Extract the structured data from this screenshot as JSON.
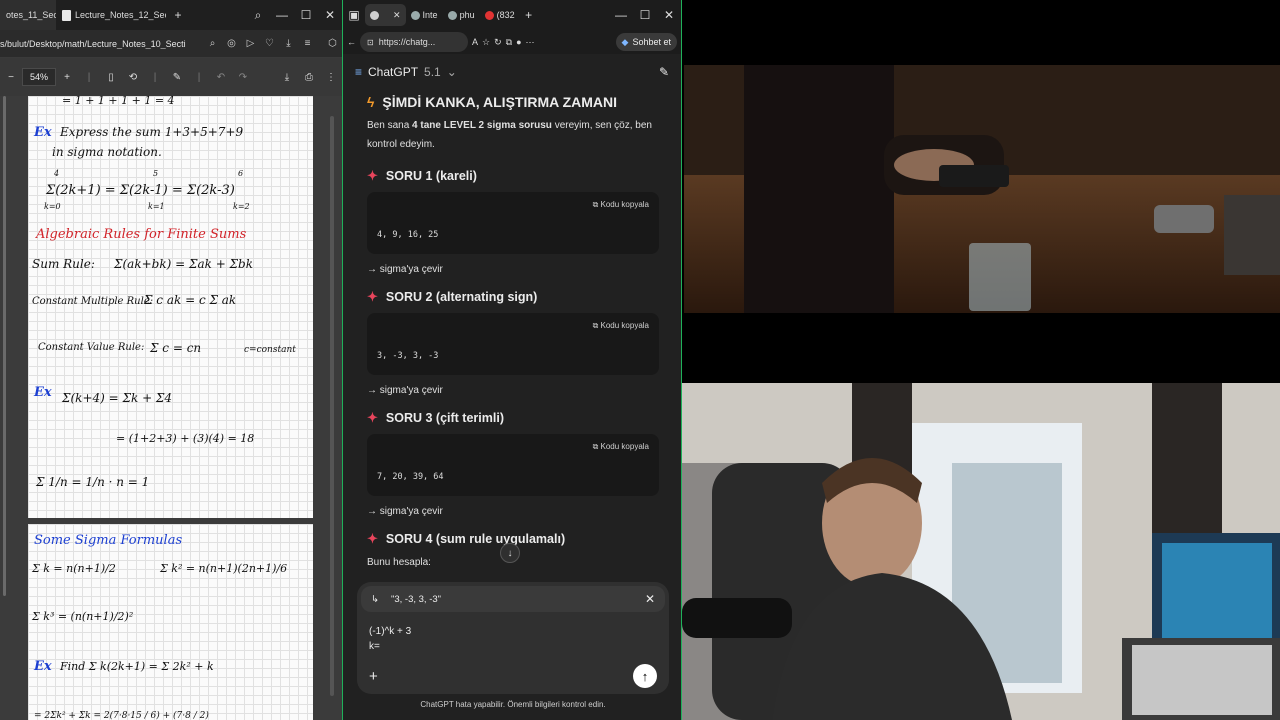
{
  "pdf": {
    "tabs": [
      {
        "label": "otes_11_Section"
      },
      {
        "label": "Lecture_Notes_12_Section"
      }
    ],
    "new_tab": "+",
    "address": "s/bulut/Desktop/math/Lecture_Notes_10_Secti",
    "zoom": "54%",
    "notes_page1": {
      "line_top": "= 1 + 1 + 1 + 1 = 4",
      "ex1_label": "Ex",
      "ex1_text": "Express the sum 1+3+5+7+9",
      "ex1_text2": "in sigma notation.",
      "ex1_sums": "Σ(2k+1) = Σ(2k-1) = Σ(2k-3)",
      "ex1_lims": [
        "k=0",
        "4",
        "k=1",
        "5",
        "k=2",
        "6"
      ],
      "rules_title": "Algebraic Rules for Finite Sums",
      "sum_rule_label": "Sum Rule:",
      "sum_rule": "Σ(ak+bk) = Σak + Σbk",
      "const_mult_label": "Constant Multiple Rule:",
      "const_mult": "Σ c ak = c Σ ak",
      "const_val_label": "Constant Value Rule:",
      "const_val": "Σ c = cn",
      "const_val_note": "c=constant",
      "ex2_label": "Ex",
      "ex2_expr": "Σ(k+4) = Σk + Σ4",
      "ex2_result": "= (1+2+3) + (3)(4) = 18",
      "ex3_expr": "Σ 1/n = 1/n · n = 1"
    },
    "notes_page2": {
      "title": "Some Sigma Formulas",
      "f1": "Σ k = n(n+1)/2",
      "f2": "Σ k² = n(n+1)(2n+1)/6",
      "f3": "Σ k³ = (n(n+1)/2)²",
      "ex_label": "Ex",
      "ex_text": "Find Σ k(2k+1) = Σ 2k² + k",
      "ex_next": "= 2Σk² + Σk = 2(7·8·15 / 6) + (7·8 / 2)"
    }
  },
  "browser": {
    "tabs": [
      {
        "label": ""
      },
      {
        "label": "Inte"
      },
      {
        "label": "phu"
      },
      {
        "label": "(832"
      }
    ],
    "address": "https://chatg...",
    "sohbet_label": "Sohbet et"
  },
  "chat": {
    "model": "ChatGPT",
    "version": "5.1",
    "heading": "ŞİMDİ KANKA, ALIŞTIRMA ZAMANI",
    "intro_pre": "Ben sana ",
    "intro_bold": "4 tane LEVEL 2 sigma sorusu",
    "intro_post": " vereyim, sen çöz, ben kontrol edeyim.",
    "copy_label": "Kodu kopyala",
    "arrow_text": "→ sigma'ya çevir",
    "questions": [
      {
        "title": "SORU 1 (kareli)",
        "code": "4, 9, 16, 25"
      },
      {
        "title": "SORU 2 (alternating sign)",
        "code": "3, -3, 3, -3"
      },
      {
        "title": "SORU 3 (çift terimli)",
        "code": "7, 20, 39, 64"
      },
      {
        "title": "SORU 4 (sum rule uygulamalı)",
        "text": "Bunu hesapla:"
      }
    ],
    "quote": "\"3, -3, 3, -3\"",
    "draft_line1": "(-1)^k + 3",
    "draft_line2": "k=",
    "disclaimer": "ChatGPT hata yapabilir. Önemli bilgileri kontrol edin."
  },
  "colors": {
    "accent_green": "#1fb15a",
    "star_red": "#e8455c",
    "pen_blue": "#1c3fd1",
    "pen_red": "#d2242a"
  }
}
